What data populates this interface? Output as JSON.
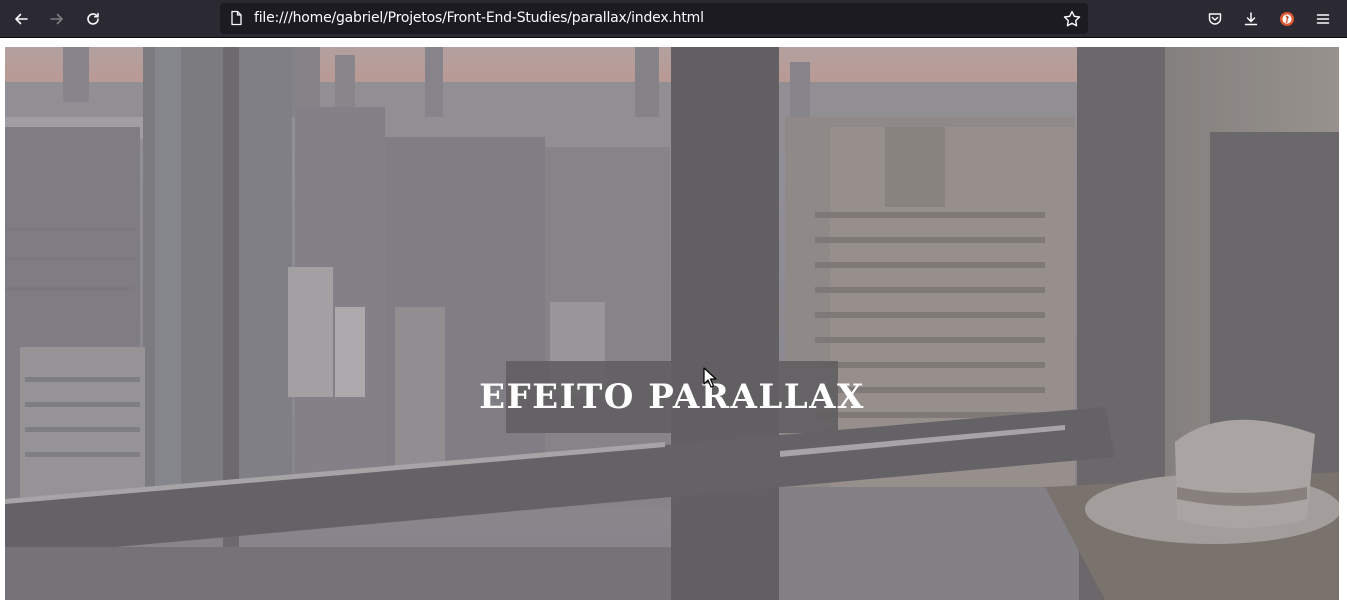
{
  "browser": {
    "url": "file:///home/gabriel/Projetos/Front-End-Studies/parallax/index.html",
    "icons": {
      "back": "arrow-left-icon",
      "forward": "arrow-right-icon",
      "reload": "reload-icon",
      "page": "page-icon",
      "bookmark": "star-icon",
      "pocket": "pocket-icon",
      "downloads": "download-icon",
      "extension": "duckduckgo-icon",
      "menu": "hamburger-menu-icon"
    }
  },
  "page": {
    "hero_title": "EFEITO PARALLAX"
  }
}
